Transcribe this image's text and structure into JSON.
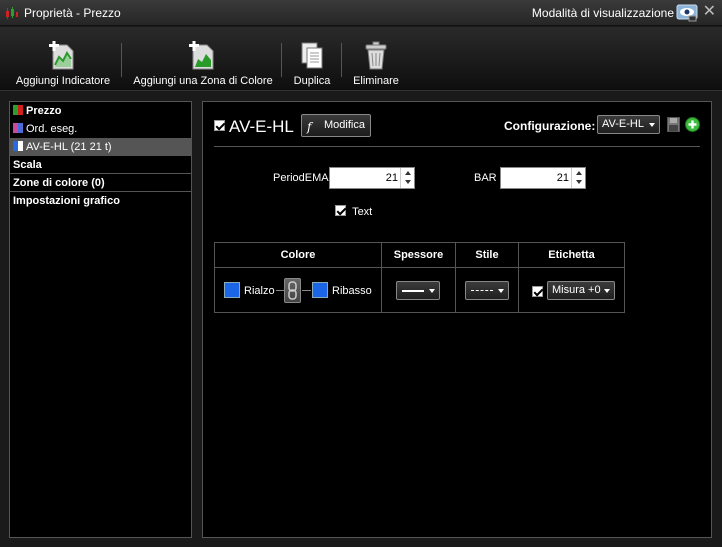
{
  "window": {
    "title": "Proprietà - Prezzo",
    "mode_label": "Modalità di visualizzazione",
    "close_glyph": "✕"
  },
  "toolbar": {
    "add_indicator": "Aggiungi Indicatore",
    "add_color_zone": "Aggiungi una Zona di Colore",
    "duplicate": "Duplica",
    "delete": "Eliminare"
  },
  "tree": {
    "items": [
      {
        "label": "Prezzo",
        "flag_colors": [
          "#2aa02a",
          "#d02020"
        ]
      },
      {
        "label": "Ord. eseg.",
        "flag_colors": [
          "#c84a9a",
          "#4a6ad8"
        ]
      },
      {
        "label": "AV-E-HL (21 21 t)",
        "flag_colors": [
          "#2a6ae0",
          "#ffffff"
        ]
      },
      {
        "label": "Scala"
      },
      {
        "label": "Zone di colore (0)"
      },
      {
        "label": "Impostazioni grafico"
      }
    ]
  },
  "indicator": {
    "name": "AV-E-HL",
    "modify_label": "Modifica",
    "config_label": "Configurazione:",
    "config_value": "AV-E-HL"
  },
  "params": {
    "period_ema_label": "PeriodEMA",
    "period_ema_value": "21",
    "bar_label": "BAR",
    "bar_value": "21",
    "text_label": "Text"
  },
  "style_table": {
    "headers": [
      "Colore",
      "Spessore",
      "Stile",
      "Etichetta"
    ],
    "rise_label": "Rialzo",
    "fall_label": "Ribasso",
    "label_value": "Misura +0"
  },
  "colors": {
    "rise": "#1a66e6",
    "fall": "#1a66e6",
    "add_green": "#3cbc3c"
  }
}
